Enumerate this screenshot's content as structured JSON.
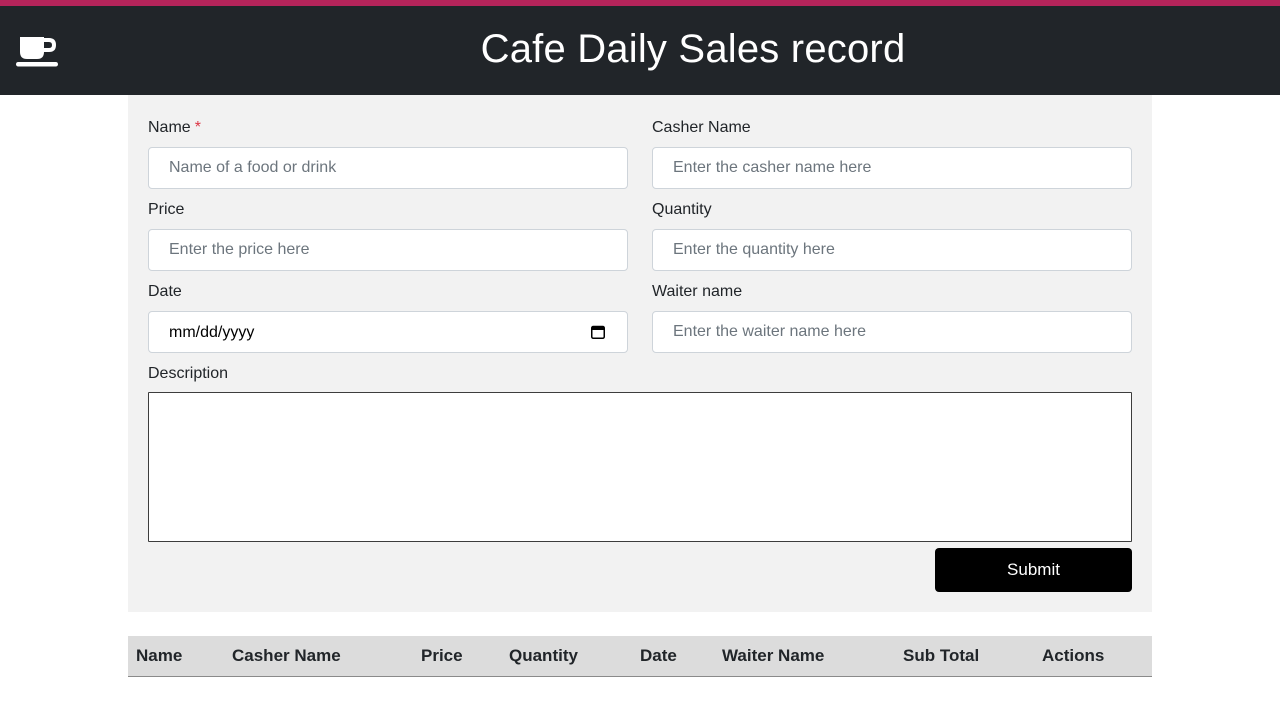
{
  "header": {
    "title": "Cafe Daily Sales record",
    "logo_icon": "coffee-cup-icon",
    "accent_color": "#b5245a",
    "background_color": "#212529"
  },
  "form": {
    "name": {
      "label": "Name",
      "required_mark": "*",
      "placeholder": "Name of a food or drink",
      "value": ""
    },
    "casher": {
      "label": "Casher Name",
      "placeholder": "Enter the casher name here",
      "value": ""
    },
    "price": {
      "label": "Price",
      "placeholder": "Enter the price here",
      "value": ""
    },
    "quantity": {
      "label": "Quantity",
      "placeholder": "Enter the quantity here",
      "value": ""
    },
    "date": {
      "label": "Date",
      "display_value": "mm/dd/yyyy",
      "icon": "calendar-icon"
    },
    "waiter": {
      "label": "Waiter name",
      "placeholder": "Enter the waiter name here",
      "value": ""
    },
    "description": {
      "label": "Description",
      "value": ""
    },
    "submit_label": "Submit"
  },
  "table": {
    "columns": [
      "Name",
      "Casher Name",
      "Price",
      "Quantity",
      "Date",
      "Waiter Name",
      "Sub Total",
      "Actions"
    ],
    "rows": []
  }
}
